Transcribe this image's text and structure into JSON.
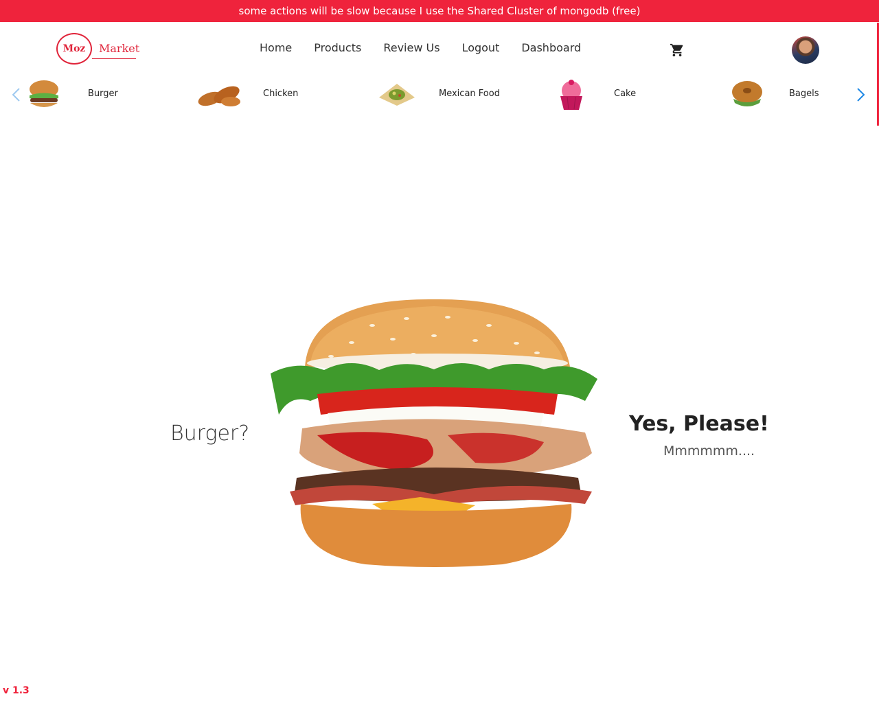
{
  "banner": {
    "text": "some actions will be slow because I use the Shared Cluster of mongodb (free)"
  },
  "logo": {
    "mark": "Moz",
    "text": "Market"
  },
  "nav": {
    "items": [
      {
        "label": "Home"
      },
      {
        "label": "Products"
      },
      {
        "label": "Review Us"
      },
      {
        "label": "Logout"
      },
      {
        "label": "Dashboard"
      }
    ]
  },
  "header": {
    "cart_icon": "shopping-cart-icon",
    "avatar_icon": "user-avatar"
  },
  "categories": {
    "items": [
      {
        "label": "Burger",
        "icon": "burger-thumbnail"
      },
      {
        "label": "Chicken",
        "icon": "chicken-thumbnail"
      },
      {
        "label": "Mexican Food",
        "icon": "mexican-food-thumbnail"
      },
      {
        "label": "Cake",
        "icon": "cake-thumbnail"
      },
      {
        "label": "Bagels",
        "icon": "bagel-thumbnail"
      }
    ],
    "prev_icon": "chevron-left-icon",
    "next_icon": "chevron-right-icon"
  },
  "hero": {
    "left_text": "Burger?",
    "right_title": "Yes, Please!",
    "right_sub": "Mmmmmm....",
    "image": "burger-image"
  },
  "footer": {
    "version": "v 1.3"
  },
  "colors": {
    "accent": "#ef233c",
    "arrow": "#1e88e5"
  }
}
